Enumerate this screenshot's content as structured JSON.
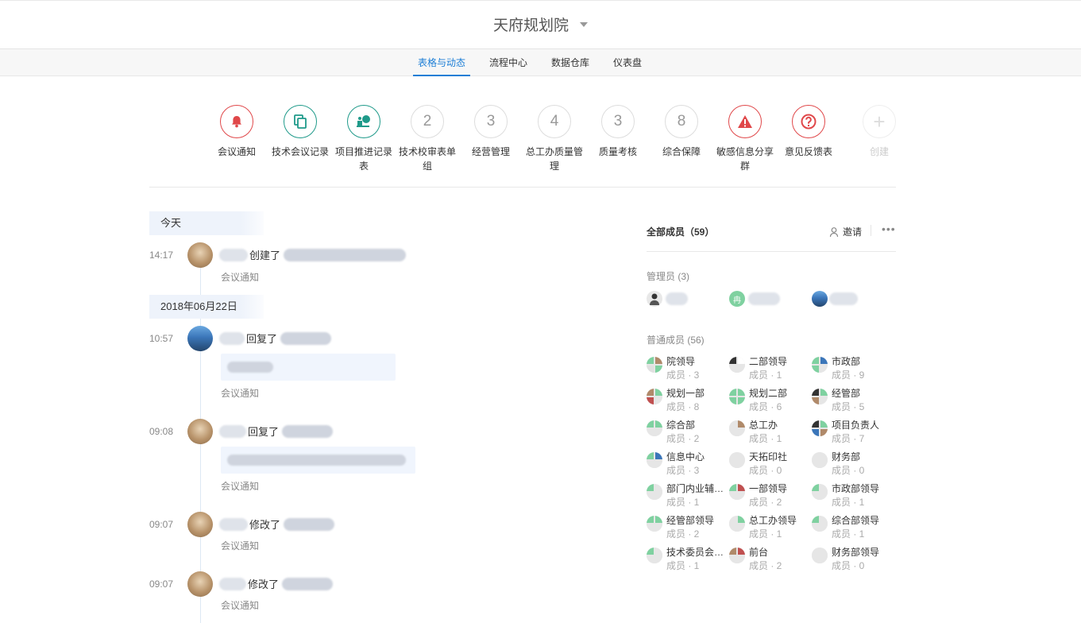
{
  "header": {
    "org_name": "天府规划院"
  },
  "tabs": [
    {
      "label": "表格与动态",
      "active": true
    },
    {
      "label": "流程中心"
    },
    {
      "label": "数据仓库"
    },
    {
      "label": "仪表盘"
    }
  ],
  "apps": [
    {
      "label": "会议通知",
      "icon": "bell-icon",
      "style": "red"
    },
    {
      "label": "技术会议记录",
      "icon": "copy-icon",
      "style": "teal"
    },
    {
      "label": "项目推进记录表",
      "icon": "presenter-icon",
      "style": "teal"
    },
    {
      "label": "技术校审表单组",
      "badge": "2"
    },
    {
      "label": "经营管理",
      "badge": "3"
    },
    {
      "label": "总工办质量管理",
      "badge": "4"
    },
    {
      "label": "质量考核",
      "badge": "3"
    },
    {
      "label": "综合保障",
      "badge": "8"
    },
    {
      "label": "敏感信息分享群",
      "icon": "warning-icon",
      "style": "red"
    },
    {
      "label": "意见反馈表",
      "icon": "question-icon",
      "style": "red"
    },
    {
      "label": "创建",
      "icon": "plus-icon",
      "style": "faint"
    }
  ],
  "feed": {
    "today_label": "今天",
    "date_label": "2018年06月22日",
    "items": [
      {
        "time": "14:17",
        "action": "创建了",
        "source": "会议通知"
      },
      {
        "time": "10:57",
        "action": "回复了",
        "source": "会议通知"
      },
      {
        "time": "09:08",
        "action": "回复了",
        "source": "会议通知"
      },
      {
        "time": "09:07",
        "action": "修改了",
        "source": "会议通知"
      },
      {
        "time": "09:07",
        "action": "修改了",
        "source": "会议通知"
      }
    ]
  },
  "members": {
    "title": "全部成员（59）",
    "invite_label": "邀请",
    "more_label": "•••",
    "admins_label": "管理员 (3)",
    "admin_initial": "冉",
    "regular_label": "普通成员 (56)",
    "count_prefix": "成员 · ",
    "groups": [
      {
        "name": "院领导",
        "count": "3"
      },
      {
        "name": "二部领导",
        "count": "1"
      },
      {
        "name": "市政部",
        "count": "9"
      },
      {
        "name": "规划一部",
        "count": "8"
      },
      {
        "name": "规划二部",
        "count": "6"
      },
      {
        "name": "经管部",
        "count": "5"
      },
      {
        "name": "综合部",
        "count": "2"
      },
      {
        "name": "总工办",
        "count": "1"
      },
      {
        "name": "项目负责人",
        "count": "7"
      },
      {
        "name": "信息中心",
        "count": "3"
      },
      {
        "name": "天拓印社",
        "count": "0"
      },
      {
        "name": "财务部",
        "count": "0"
      },
      {
        "name": "部门内业辅…",
        "count": "1"
      },
      {
        "name": "一部领导",
        "count": "2"
      },
      {
        "name": "市政部领导",
        "count": "1"
      },
      {
        "name": "经管部领导",
        "count": "2"
      },
      {
        "name": "总工办领导",
        "count": "1"
      },
      {
        "name": "综合部领导",
        "count": "1"
      },
      {
        "name": "技术委员会…",
        "count": "1"
      },
      {
        "name": "前台",
        "count": "2"
      },
      {
        "name": "财务部领导",
        "count": "0"
      }
    ]
  },
  "colors": {
    "accent": "#1c7ed6",
    "red": "#e0484a",
    "teal": "#1f9a8a",
    "green": "#7fd1a0"
  }
}
